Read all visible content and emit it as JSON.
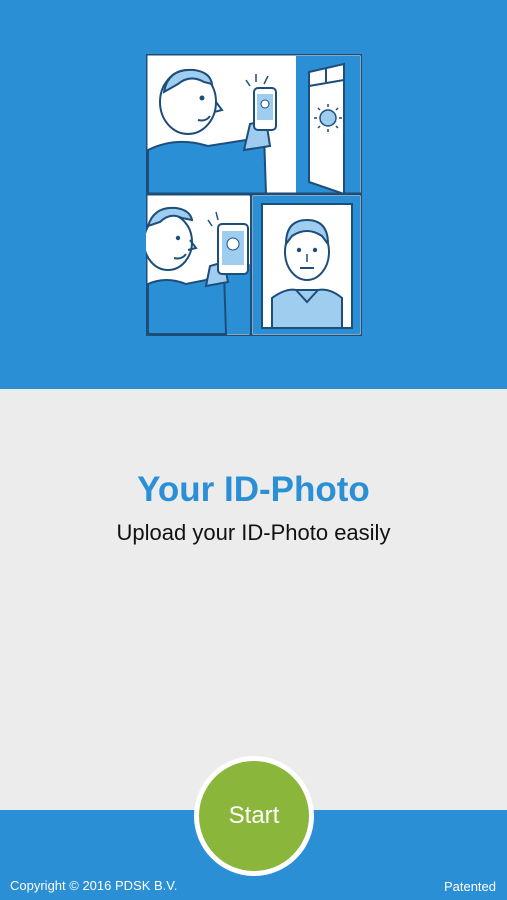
{
  "screen": {
    "title": "Your ID-Photo",
    "subtitle": "Upload your ID-Photo easily"
  },
  "actions": {
    "start_label": "Start"
  },
  "footer": {
    "copyright": "Copyright © 2016 PDSK B.V.",
    "patent_note": "Patented"
  },
  "illustration": {
    "icon": "selfie-id-photo-illustration"
  },
  "colors": {
    "primary_blue": "#2b8fd6",
    "light_blue": "#9fcdf0",
    "dark_navy": "#1d4e7a",
    "background": "#ececec",
    "start_green": "#8bb63c"
  }
}
